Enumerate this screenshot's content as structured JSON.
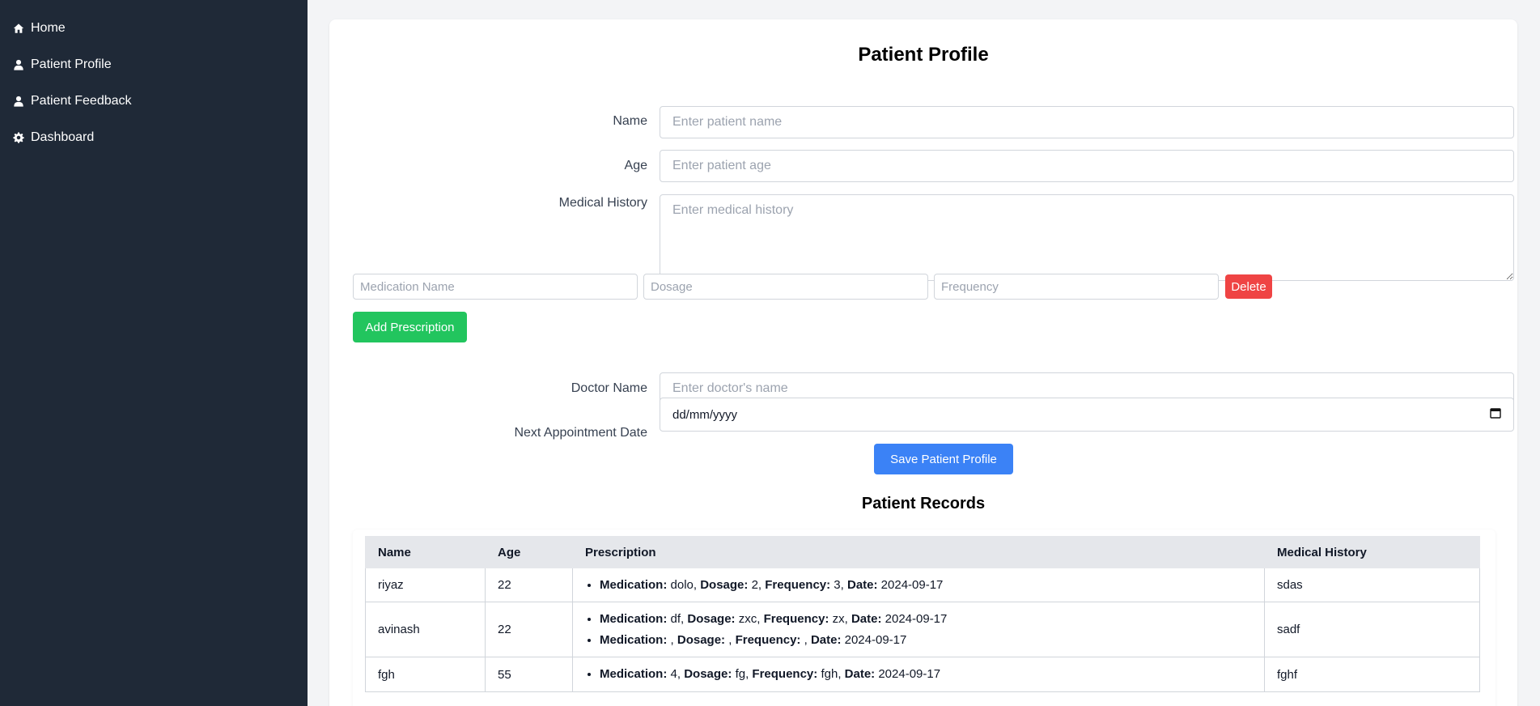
{
  "sidebar": {
    "items": [
      {
        "label": "Home",
        "icon": "home-icon"
      },
      {
        "label": "Patient Profile",
        "icon": "user-icon"
      },
      {
        "label": "Patient Feedback",
        "icon": "user-icon"
      },
      {
        "label": "Dashboard",
        "icon": "gear-icon"
      }
    ]
  },
  "form": {
    "title": "Patient Profile",
    "name_label": "Name",
    "name_placeholder": "Enter patient name",
    "age_label": "Age",
    "age_placeholder": "Enter patient age",
    "history_label": "Medical History",
    "history_placeholder": "Enter medical history",
    "medication_placeholder": "Medication Name",
    "dosage_placeholder": "Dosage",
    "frequency_placeholder": "Frequency",
    "delete_label": "Delete",
    "add_prescription_label": "Add Prescription",
    "doctor_label": "Doctor Name",
    "doctor_placeholder": "Enter doctor's name",
    "appointment_label": "Next Appointment Date",
    "appointment_value": "dd/mm/yyyy",
    "save_label": "Save Patient Profile"
  },
  "records": {
    "title": "Patient Records",
    "columns": [
      "Name",
      "Age",
      "Prescription",
      "Medical History"
    ],
    "field_labels": {
      "medication": "Medication:",
      "dosage": "Dosage:",
      "frequency": "Frequency:",
      "date": "Date:"
    },
    "rows": [
      {
        "name": "riyaz",
        "age": "22",
        "history": "sdas",
        "prescriptions": [
          {
            "medication": "dolo",
            "dosage": "2",
            "frequency": "3",
            "date": "2024-09-17"
          }
        ]
      },
      {
        "name": "avinash",
        "age": "22",
        "history": "sadf",
        "prescriptions": [
          {
            "medication": "df",
            "dosage": "zxc",
            "frequency": "zx",
            "date": "2024-09-17"
          },
          {
            "medication": "",
            "dosage": "",
            "frequency": "",
            "date": "2024-09-17"
          }
        ]
      },
      {
        "name": "fgh",
        "age": "55",
        "history": "fghf",
        "prescriptions": [
          {
            "medication": "4",
            "dosage": "fg",
            "frequency": "fgh",
            "date": "2024-09-17"
          }
        ]
      }
    ]
  },
  "colors": {
    "sidebar_bg": "#1f2937",
    "delete": "#ef4444",
    "add": "#22c55e",
    "save": "#3b82f6"
  }
}
